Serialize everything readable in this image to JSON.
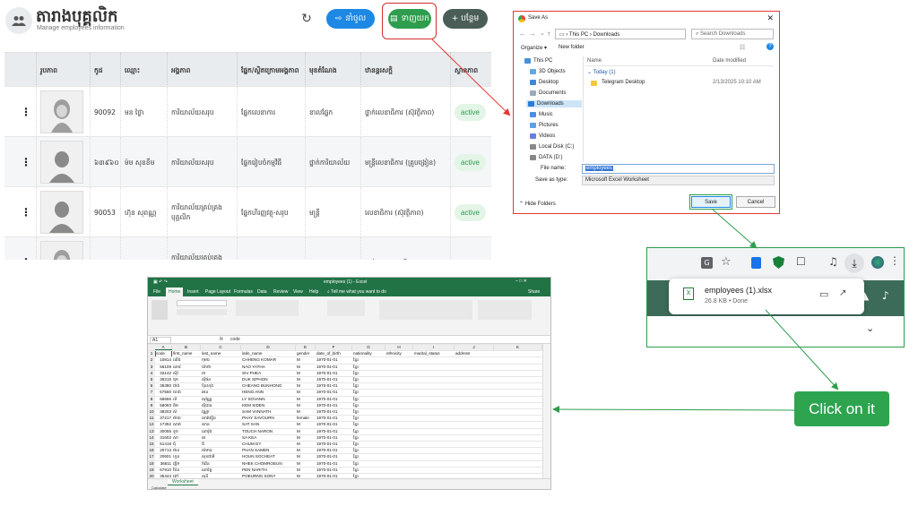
{
  "app": {
    "title": "តារាងបុគ្គលិក",
    "subtitle": "Manage employees information",
    "buttons": {
      "import": "នាំចូល",
      "export": "ទាញយក",
      "add": "+ បន្ថែម"
    },
    "columns": [
      "រូបភាព",
      "កូដ",
      "ឈ្មោះ",
      "អង្គភាព",
      "ផ្នែក/ស្ថិតក្រោមអង្គភាព",
      "មុខតំណែង",
      "ឋានន្តរសក្តិ",
      "ស្ថានភាព"
    ],
    "rows": [
      {
        "code": "90092",
        "name": "មន ថ្ងៃា",
        "unit": "ការិយាល័យសរុប",
        "dept": "ផ្នែកលេខាការ",
        "position": "ខាលផ្នែក",
        "rank": "ថ្នាក់លេខាធិការ (ស៊ុវត្ថិភាព)",
        "status": "active",
        "gender": "female"
      },
      {
        "code": "៦៣៩៦០",
        "name": "ម៉ម សុខខឹម",
        "unit": "ការិយាល័យសរុប",
        "dept": "ផ្នែករៀបចំកម្មវិធី",
        "position": "ថ្នាក់ការិយាល័យ",
        "rank": "មន្ត្រីលេខាធិការ (គ្រូបង្រៀន)",
        "status": "active",
        "gender": "male"
      },
      {
        "code": "90053",
        "name": "ហ៊ុន សុពណ្ណ",
        "unit": "ការិយាល័យគ្រប់គ្រងបុគ្គលិក",
        "dept": "ផ្នែកហិរញ្ញវត្ថុ-សរុប",
        "position": "មន្ត្រី",
        "rank": "លេខាធិការ (ស៊ុវត្ថិភាព)",
        "status": "active",
        "gender": "male"
      },
      {
        "code": "",
        "name": "",
        "unit": "ការិយាល័យគ្រប់គ្រងបុគ្គលិក",
        "dept": "",
        "position": "",
        "rank": "ថ្នាក់ឧត្តមលេខាធិការ",
        "status": "",
        "gender": "female"
      }
    ]
  },
  "save_dialog": {
    "title": "Save As",
    "path": [
      "This PC",
      "Downloads"
    ],
    "search_placeholder": "Search Downloads",
    "organize": "Organize ▾",
    "new_folder": "New folder",
    "tree": [
      "This PC",
      "3D Objects",
      "Desktop",
      "Documents",
      "Downloads",
      "Music",
      "Pictures",
      "Videos",
      "Local Disk (C:)",
      "DATA (D:)"
    ],
    "columns": {
      "name": "Name",
      "modified": "Date modified"
    },
    "group": "Today (1)",
    "files": [
      {
        "name": "Telegram Desktop",
        "modified": "2/13/2025 10:10 AM"
      }
    ],
    "file_name_label": "File name:",
    "file_name": "employees",
    "save_type_label": "Save as type:",
    "save_type": "Microsoft Excel Worksheet",
    "hide_folders": "Hide Folders",
    "save": "Save",
    "cancel": "Cancel"
  },
  "download_popup": {
    "file_name": "employees (1).xlsx",
    "meta": "26.8 KB • Done"
  },
  "excel": {
    "title": "employees (1) - Excel",
    "tabs": [
      "File",
      "Home",
      "Insert",
      "Page Layout",
      "Formulas",
      "Data",
      "Review",
      "View",
      "Help"
    ],
    "tell_me": "Tell me what you want to do",
    "share": "Share",
    "cell_ref": "A1",
    "formula": "code",
    "headers": [
      "code",
      "first_name",
      "last_name",
      "latin_name",
      "gender",
      "date_of_birth",
      "nationality",
      "ethnicity",
      "marital_status",
      "address"
    ],
    "rows": [
      [
        "10814",
        "ឈីង",
        "កុមារ",
        "CHHENG KOMAR",
        "M",
        "1970-01-01",
        "ខ្មែរ"
      ],
      [
        "56109",
        "ណាវ",
        "យ៉ាថា",
        "NAO YATHA",
        "M",
        "1970-01-01",
        "ខ្មែរ"
      ],
      [
        "33142",
        "ស៊ីវ",
        "ភា",
        "SIV PHEA",
        "M",
        "1970-01-01",
        "ខ្មែរ"
      ],
      [
        "36215",
        "ឌុក",
        "ស៊ីផន",
        "DUK SIPHON",
        "M",
        "1970-01-01",
        "ខ្មែរ"
      ],
      [
        "35380",
        "ជាង",
        "ប៊ុនហុង",
        "CHEANG BUNHONG",
        "M",
        "1970-01-01",
        "ខ្មែរ"
      ],
      [
        "57550",
        "ហេង",
        "អាន",
        "HENG ANN",
        "M",
        "1970-01-01",
        "ខ្មែរ"
      ],
      [
        "66666",
        "លី",
        "សុវណ្ណ",
        "LY SOVANN",
        "M",
        "1970-01-01",
        "ខ្មែរ"
      ],
      [
        "58083",
        "គឹម",
        "ស៊ីដេន",
        "KEM SIDEN",
        "M",
        "1970-01-01",
        "ខ្មែរ"
      ],
      [
        "38203",
        "សំ",
        "វណ្ណា",
        "SAM VANNATH",
        "M",
        "1970-01-01",
        "ខ្មែរ"
      ],
      [
        "37217",
        "ផាយ",
        "សាវឌឿន",
        "PHAY SAVOURN",
        "female",
        "1970-01-01",
        "ខ្មែរ"
      ],
      [
        "17352",
        "សាត់",
        "សាន",
        "SAT SAN",
        "M",
        "1970-01-01",
        "ខ្មែរ"
      ],
      [
        "30055",
        "ទូច",
        "ណារ៉ុង",
        "TOUCH NARON",
        "M",
        "1970-01-01",
        "ខ្មែរ"
      ],
      [
        "31602",
        "សា",
        "គា",
        "SA KEA",
        "M",
        "1970-01-01",
        "ខ្មែរ"
      ],
      [
        "51418",
        "ជុំ",
        "ឌី",
        "CHUM DY",
        "M",
        "1970-01-01",
        "ខ្មែរ"
      ],
      [
        "20713",
        "ផាន",
        "សំមាន",
        "PHAN SAMEN",
        "M",
        "1970-01-01",
        "ខ្មែរ"
      ],
      [
        "20601",
        "ហួន",
        "សុខជាតិ",
        "HOUN SOCHEAT",
        "M",
        "1970-01-01",
        "ខ្មែរ"
      ],
      [
        "36811",
        "ញឹក",
        "ចំរើន",
        "NHEK CHOMROEUN",
        "M",
        "1970-01-01",
        "ខ្មែរ"
      ],
      [
        "67910",
        "ប៉ែន",
        "ណារិទ្ធ",
        "PEN NARITH",
        "M",
        "1970-01-01",
        "ខ្មែរ"
      ],
      [
        "35444",
        "ពៅ",
        "សុនី",
        "POEURNG SONY",
        "M",
        "1970-01-01",
        "ខ្មែរ"
      ],
      [
        "37153",
        "សៀង",
        "សាលី",
        "SEANG SALY",
        "M",
        "1970-01-01",
        "ខ្មែរ"
      ],
      [
        "93784",
        "គីម",
        "ប៊ុនថា",
        "KIM BUNTHA",
        "M",
        "1970-01-01",
        "ខ្មែរ"
      ]
    ],
    "sheet_tab": "Worksheet",
    "status": "Calculate"
  },
  "callout": "Click on it",
  "colors": {
    "annotation_red": "#e53935",
    "annotation_green": "#2e9d4e",
    "excel_green": "#217346"
  }
}
